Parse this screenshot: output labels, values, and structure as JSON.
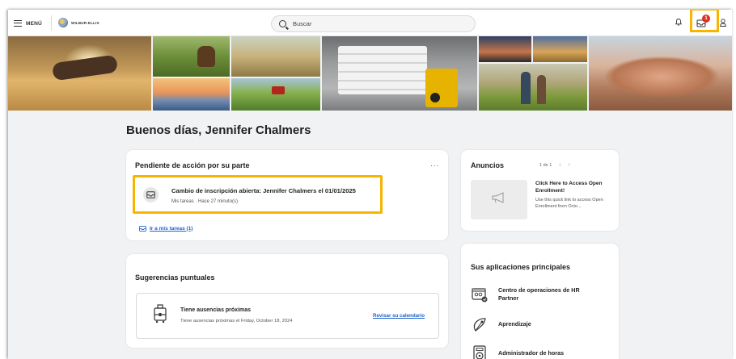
{
  "topbar": {
    "menu_label": "MENÚ",
    "logo_text": "WILBUR-ELLIS",
    "search_placeholder": "Buscar",
    "inbox_badge": "1"
  },
  "greeting": "Buenos días, Jennifer Chalmers",
  "pending": {
    "title": "Pendiente de acción por su parte",
    "more": "···",
    "task_title": "Cambio de inscripción abierta: Jennifer Chalmers el 01/01/2025",
    "task_meta": "Mis tareas · Hace 27 minuto(s)",
    "link_label": "Ir a mis tareas (1)"
  },
  "announcements": {
    "title": "Anuncios",
    "pager": "1 de 1",
    "item_title": "Click Here to Access Open Enrollment!",
    "item_desc": "Use this quick link to access Open Enrollment from Octo..."
  },
  "suggestions": {
    "title": "Sugerencias puntuales",
    "item_title": "Tiene ausencias próximas",
    "item_desc": "Tiene ausencias próximas el Friday, October 18, 2024",
    "item_link": "Revisar su calendario"
  },
  "apps": {
    "title": "Sus aplicaciones principales",
    "items": [
      {
        "label": "Centro de operaciones de HR Partner",
        "icon": "hr-partner-icon"
      },
      {
        "label": "Aprendizaje",
        "icon": "learning-icon"
      },
      {
        "label": "Administrador de horas",
        "icon": "time-manager-icon"
      }
    ]
  },
  "colors": {
    "highlight": "#f7b500",
    "link": "#1e62c9",
    "badge": "#de2e21"
  }
}
